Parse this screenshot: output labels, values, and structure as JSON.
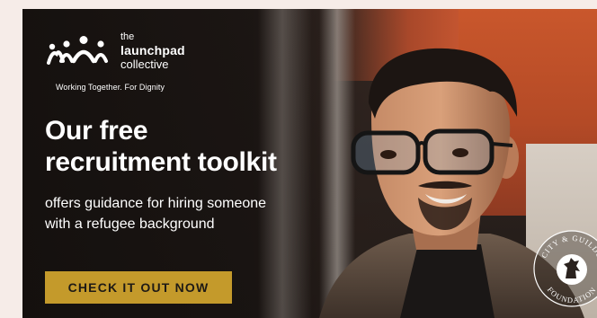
{
  "logo": {
    "line1": "the",
    "line2": "launchpad",
    "line3": "collective",
    "tagline": "Working Together. For Dignity"
  },
  "headline": {
    "line1": "Our free",
    "line2": "recruitment toolkit"
  },
  "subtext": {
    "line1": "offers guidance for hiring someone",
    "line2": "with a refugee background"
  },
  "cta": {
    "label": "CHECK IT OUT NOW"
  },
  "seal": {
    "text_top": "CITY & GUILDS",
    "text_bottom": "FOUNDATION"
  },
  "colors": {
    "cta_background": "#c49a2b",
    "accent_orange": "#c9572c",
    "text": "#ffffff"
  }
}
